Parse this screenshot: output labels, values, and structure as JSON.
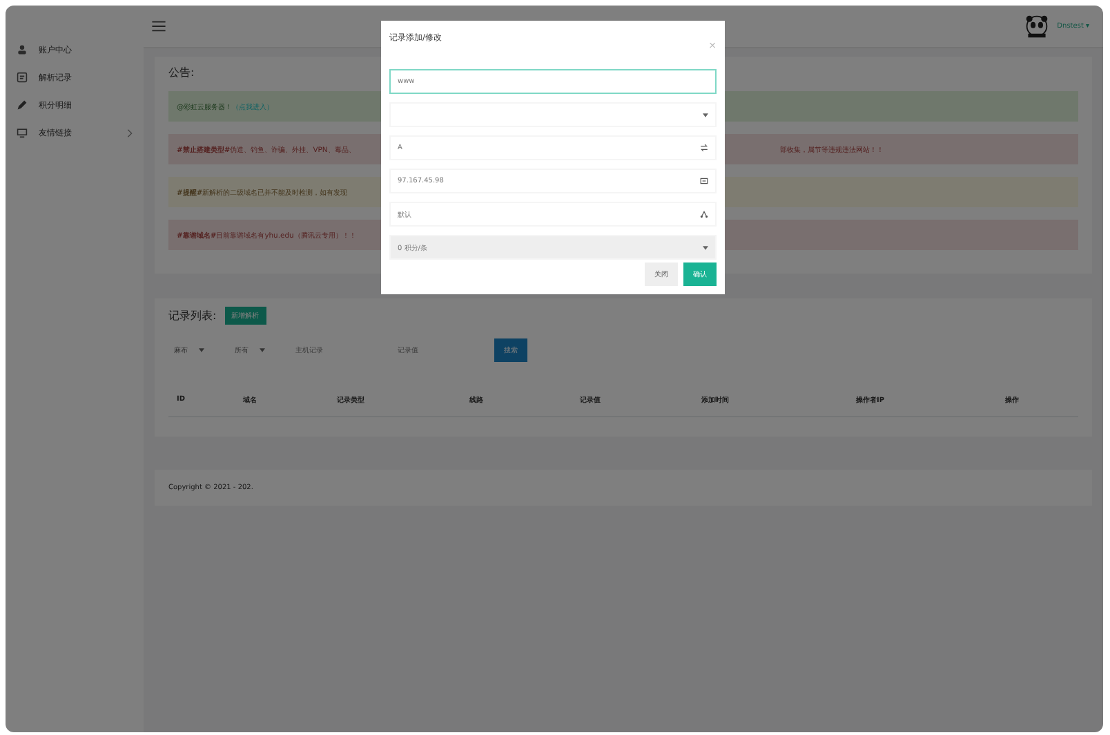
{
  "header": {
    "user": "Dnstest ▾"
  },
  "sidebar": {
    "items": [
      {
        "label": "账户中心",
        "arrow": false
      },
      {
        "label": "解析记录",
        "arrow": false
      },
      {
        "label": "积分明细",
        "arrow": false
      },
      {
        "label": "友情链接",
        "arrow": true
      }
    ]
  },
  "notice": {
    "title": "公告:",
    "items": [
      {
        "kind": "success",
        "text": "@彩虹云服务器！",
        "link": "（点我进入）"
      },
      {
        "kind": "danger",
        "tag": "#禁止搭建类型#",
        "text": "伪造、钓鱼、诈骗、外挂、VPN、毒品、",
        "tail": "部收集，属节等违规违法网站！！"
      },
      {
        "kind": "warning",
        "tag": "#提醒#",
        "text": "新解析的二级域名已并不能及时检测，如有发现"
      },
      {
        "kind": "danger",
        "tag": "#靠谱域名#",
        "text": "目前靠谱域名有yhu.edu（腾讯云专用）！！"
      }
    ]
  },
  "records": {
    "title": "记录列表:",
    "add_button": "新增解析",
    "filters": {
      "select_1": "麻布",
      "select_2": "所有",
      "host_placeholder": "主机记录",
      "value_placeholder": "记录值",
      "search_button": "搜索"
    },
    "columns": [
      "ID",
      "域名",
      "记录类型",
      "线路",
      "记录值",
      "添加时间",
      "操作者IP",
      "操作"
    ]
  },
  "footer": "Copyright © 2021 - 202.",
  "modal": {
    "title": "记录添加/修改",
    "close": "×",
    "fields": [
      {
        "kind": "input",
        "value": "www",
        "focused": true,
        "disabled": false
      },
      {
        "kind": "select",
        "focused": false,
        "disabled": false
      },
      {
        "kind": "input",
        "value": "A",
        "focused": false,
        "disabled": false
      },
      {
        "kind": "input",
        "value": "97.167.45.98",
        "focused": false,
        "disabled": false
      },
      {
        "kind": "input",
        "value": "默认",
        "focused": false,
        "disabled": false
      },
      {
        "kind": "select",
        "value": "0 积分/条",
        "focused": false,
        "disabled": true
      }
    ],
    "buttons": [
      {
        "label": "关闭",
        "primary": false
      },
      {
        "label": "确认",
        "primary": true
      }
    ]
  }
}
